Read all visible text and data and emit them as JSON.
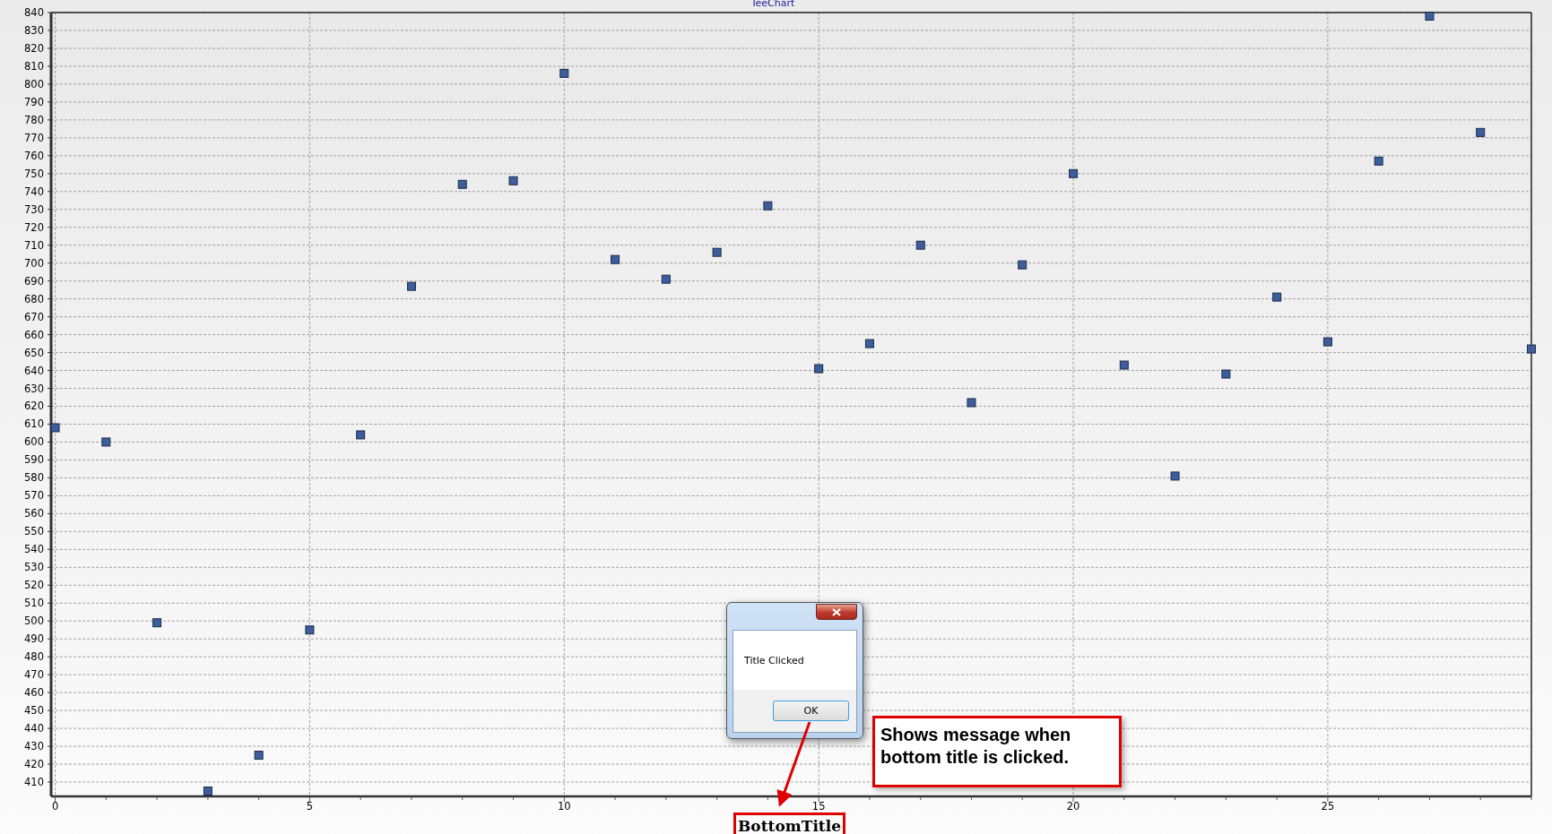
{
  "chart": {
    "chart_data": {
      "type": "scatter",
      "title": "TeeChart",
      "xlabel": "BottomTitle",
      "x": [
        0,
        1,
        2,
        3,
        4,
        5,
        6,
        7,
        8,
        9,
        10,
        11,
        12,
        13,
        14,
        15,
        16,
        17,
        18,
        19,
        20,
        21,
        22,
        23,
        24,
        25,
        26,
        27,
        28,
        29
      ],
      "series": [
        {
          "color": "#3d5d9c",
          "values": [
            608,
            600,
            499,
            405,
            425,
            495,
            604,
            687,
            744,
            746,
            806,
            702,
            691,
            706,
            732,
            641,
            655,
            710,
            622,
            699,
            750,
            643,
            581,
            638,
            681,
            656,
            757,
            838,
            773,
            652
          ]
        }
      ],
      "grid": true,
      "xlim": [
        -0.08,
        29
      ],
      "ylim": [
        402,
        840
      ],
      "xticks": [
        0,
        5,
        10,
        15,
        20,
        25
      ],
      "yticks": [
        410,
        420,
        430,
        440,
        450,
        460,
        470,
        480,
        490,
        500,
        510,
        520,
        530,
        540,
        550,
        560,
        570,
        580,
        590,
        600,
        610,
        620,
        630,
        640,
        650,
        660,
        670,
        680,
        690,
        700,
        710,
        720,
        730,
        740,
        750,
        760,
        770,
        780,
        790,
        800,
        810,
        820,
        830,
        840
      ]
    }
  },
  "dialog": {
    "message": "Title Clicked",
    "button": "OK"
  },
  "callout": {
    "text": "Shows message when bottom title is clicked."
  }
}
